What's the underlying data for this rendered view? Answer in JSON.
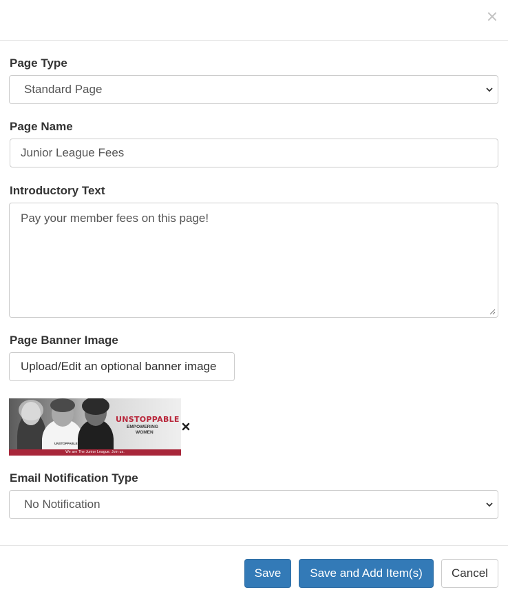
{
  "dialog": {
    "close_label": "×"
  },
  "page_type": {
    "label": "Page Type",
    "selected": "Standard Page"
  },
  "page_name": {
    "label": "Page Name",
    "value": "Junior League Fees"
  },
  "intro_text": {
    "label": "Introductory Text",
    "value": "Pay your member fees on this page!"
  },
  "banner": {
    "label": "Page Banner Image",
    "upload_button": "Upload/Edit an optional banner image",
    "image": {
      "brand": "UNSTOPPABLE",
      "tagline_1": "EMPOWERING",
      "tagline_2": "WOMEN",
      "shirt": "UNSTOPPABLE",
      "footer": "We are The Junior League. Join us."
    }
  },
  "email_notification": {
    "label": "Email Notification Type",
    "selected": "No Notification"
  },
  "footer": {
    "save": "Save",
    "save_add": "Save and Add Item(s)",
    "cancel": "Cancel"
  },
  "colors": {
    "primary": "#337ab7",
    "brand_red": "#b8263a"
  }
}
